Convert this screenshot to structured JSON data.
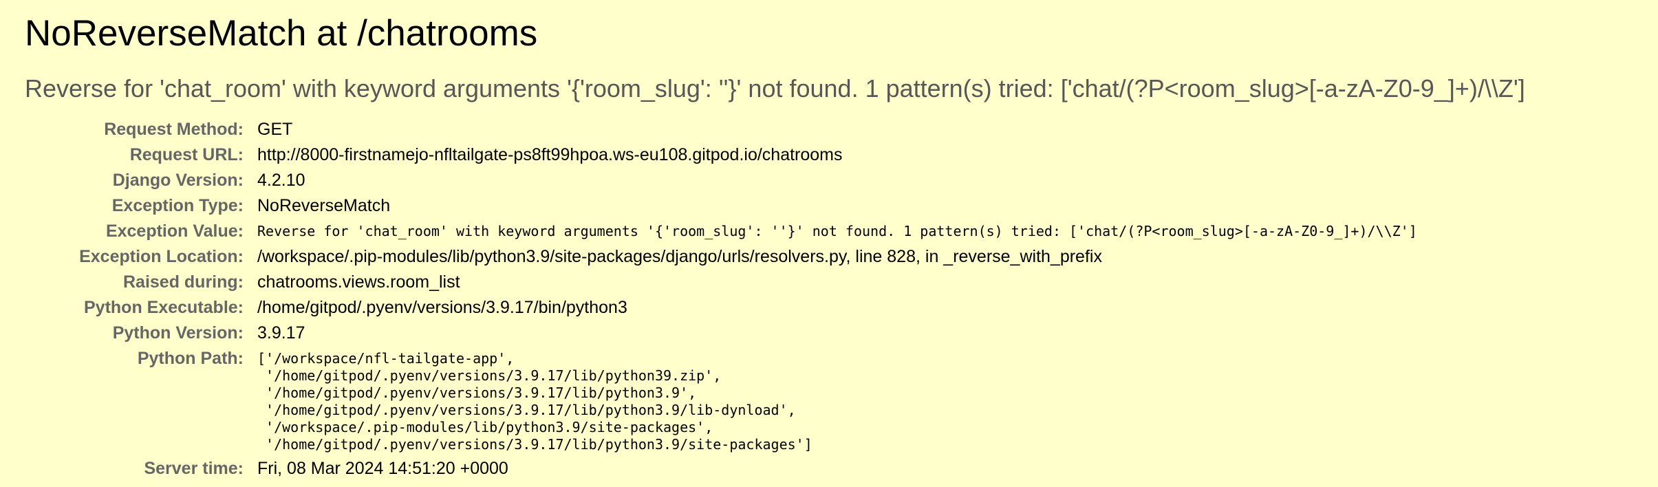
{
  "page": {
    "title": "NoReverseMatch at /chatrooms",
    "exception_value": "Reverse for 'chat_room' with keyword arguments '{'room_slug': ''}' not found. 1 pattern(s) tried: ['chat/(?P<room_slug>[-a-zA-Z0-9_]+)/\\\\Z']"
  },
  "meta": {
    "request_method": {
      "label": "Request Method:",
      "value": "GET"
    },
    "request_url": {
      "label": "Request URL:",
      "value": "http://8000-firstnamejo-nfltailgate-ps8ft99hpoa.ws-eu108.gitpod.io/chatrooms"
    },
    "django_version": {
      "label": "Django Version:",
      "value": "4.2.10"
    },
    "exception_type": {
      "label": "Exception Type:",
      "value": "NoReverseMatch"
    },
    "exception_value": {
      "label": "Exception Value:",
      "value": "Reverse for 'chat_room' with keyword arguments '{'room_slug': ''}' not found. 1 pattern(s) tried: ['chat/(?P<room_slug>[-a-zA-Z0-9_]+)/\\\\Z']"
    },
    "exception_location": {
      "label": "Exception Location:",
      "value": "/workspace/.pip-modules/lib/python3.9/site-packages/django/urls/resolvers.py, line 828, in _reverse_with_prefix"
    },
    "raised_during": {
      "label": "Raised during:",
      "value": "chatrooms.views.room_list"
    },
    "python_executable": {
      "label": "Python Executable:",
      "value": "/home/gitpod/.pyenv/versions/3.9.17/bin/python3"
    },
    "python_version": {
      "label": "Python Version:",
      "value": "3.9.17"
    },
    "python_path": {
      "label": "Python Path:",
      "lines": [
        "['/workspace/nfl-tailgate-app',",
        " '/home/gitpod/.pyenv/versions/3.9.17/lib/python39.zip',",
        " '/home/gitpod/.pyenv/versions/3.9.17/lib/python3.9',",
        " '/home/gitpod/.pyenv/versions/3.9.17/lib/python3.9/lib-dynload',",
        " '/workspace/.pip-modules/lib/python3.9/site-packages',",
        " '/home/gitpod/.pyenv/versions/3.9.17/lib/python3.9/site-packages']"
      ]
    },
    "server_time": {
      "label": "Server time:",
      "value": "Fri, 08 Mar 2024 14:51:20 +0000"
    }
  }
}
